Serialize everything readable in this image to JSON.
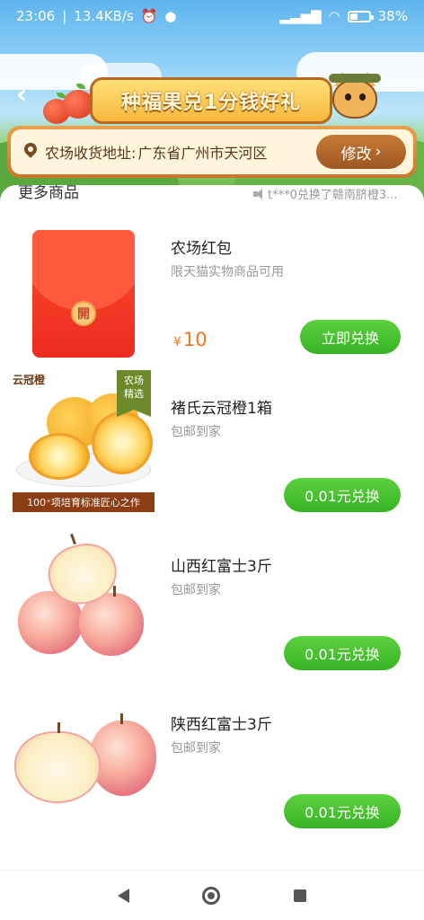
{
  "status_bar": {
    "time": "23:06",
    "speed": "13.4KB/s",
    "battery": "38",
    "battery_level": 0.38
  },
  "header": {
    "banner_title": "种福果兑1分钱好礼",
    "address_label": "农场收货地址:",
    "address_value": "广东省广州市天河区",
    "edit_button": "修改"
  },
  "section": {
    "title": "更多商品",
    "ticker": "t***0兑换了赣南脐橙3..."
  },
  "products": [
    {
      "title": "农场红包",
      "subtitle": "限天猫实物商品可用",
      "price_symbol": "¥",
      "price": "10",
      "button": "立即兑换",
      "seal": "開",
      "image": "red-envelope"
    },
    {
      "title": "褚氏云冠橙1箱",
      "subtitle": "包邮到家",
      "button": "0.01元兑换",
      "image": "oranges",
      "brand_tag": "云冠橙",
      "farm_tag_line1": "农场",
      "farm_tag_line2": "精选",
      "image_footer": "100⁺项培育标准匠心之作"
    },
    {
      "title": "山西红富士3斤",
      "subtitle": "包邮到家",
      "button": "0.01元兑换",
      "image": "apples"
    },
    {
      "title": "陕西红富士3斤",
      "subtitle": "包邮到家",
      "button": "0.01元兑换",
      "image": "apples"
    }
  ],
  "colors": {
    "accent_green": "#37b324",
    "price_orange": "#f2741b",
    "banner_brown": "#b8681f"
  },
  "navbar": {
    "back": "back-icon",
    "home": "home-icon",
    "recents": "recents-icon"
  }
}
